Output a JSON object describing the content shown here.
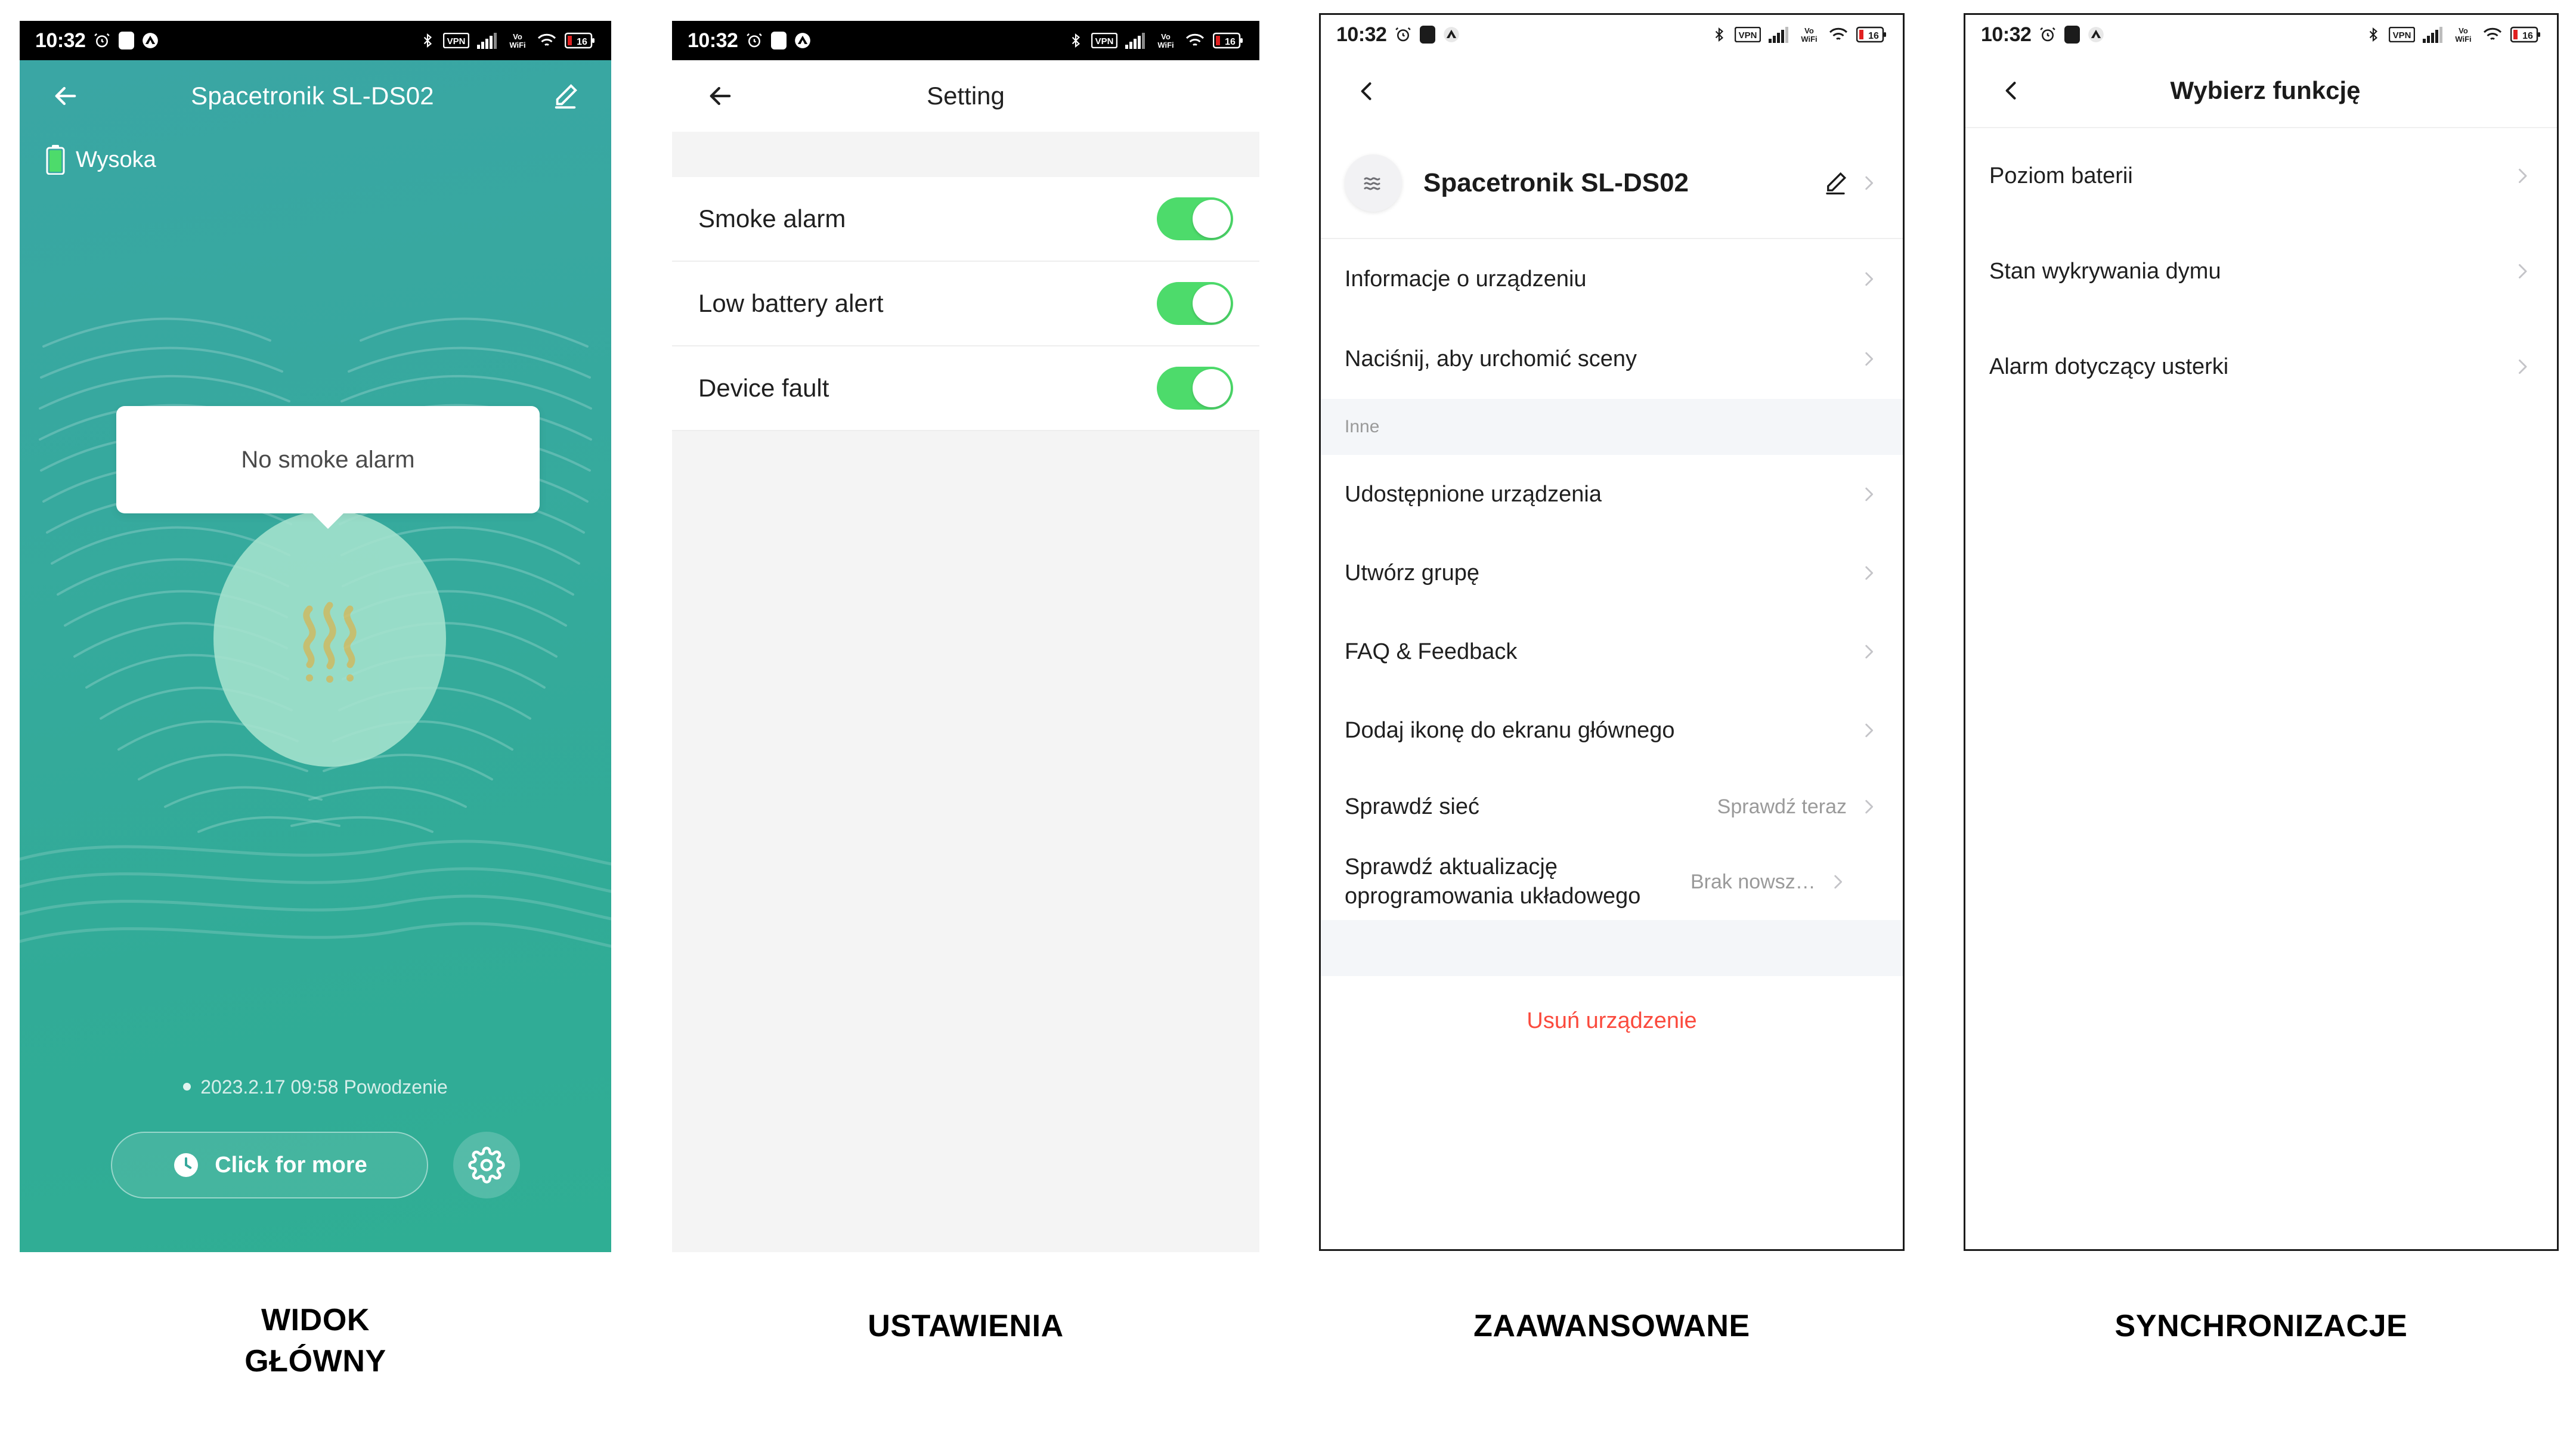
{
  "statusbar": {
    "time": "10:32",
    "icons_left": [
      "alarm-clock-icon",
      "do-not-disturb-icon",
      "nordvpn-icon"
    ],
    "icons_right": [
      "bluetooth-icon",
      "vpn-icon",
      "cellular-signal-icon",
      "volte-wifi-icon",
      "wifi-icon",
      "battery-icon"
    ],
    "battery_level": "16"
  },
  "panel1": {
    "caption": "WIDOK\nGŁÓWNY",
    "appbar": {
      "back_icon": "arrow-left-icon",
      "title": "Spacetronik SL-DS02",
      "edit_icon": "pencil-icon"
    },
    "battery": {
      "icon": "battery-full-icon",
      "label": "Wysoka"
    },
    "bubble": {
      "text": "No smoke alarm"
    },
    "blob_icon": "smoke-waves-icon",
    "log": {
      "bullet": "•",
      "text": "2023.2.17 09:58 Powodzenie"
    },
    "click_more": {
      "icon": "clock-icon",
      "label": "Click for more"
    },
    "gear": {
      "icon": "gear-icon"
    },
    "colors": {
      "teal_top": "#3aa6a4",
      "teal_bottom": "#2fae94",
      "blob": "#a5e3ce",
      "smoke": "#d9c26c"
    }
  },
  "panel2": {
    "caption": "USTAWIENIA",
    "appbar": {
      "back_icon": "arrow-left-icon",
      "title": "Setting"
    },
    "rows": [
      {
        "label": "Smoke alarm",
        "toggle": "on"
      },
      {
        "label": "Low battery alert",
        "toggle": "on"
      },
      {
        "label": "Device fault",
        "toggle": "on"
      }
    ],
    "colors": {
      "toggle_on": "#4ddb6b",
      "page_bg": "#f4f4f4"
    }
  },
  "panel3": {
    "caption": "ZAAWANSOWANE",
    "appbar": {
      "back_icon": "chevron-left-icon"
    },
    "device": {
      "avatar_icon": "smoke-waves-icon",
      "name": "Spacetronik SL-DS02",
      "edit_icon": "pencil-icon",
      "chevron_icon": "chevron-right-icon"
    },
    "rows_top": [
      {
        "label": "Informacje o urządzeniu",
        "value": "",
        "chevron": "chevron-right-icon"
      },
      {
        "label": "Naciśnij, aby urchomić sceny",
        "value": "",
        "chevron": "chevron-right-icon"
      }
    ],
    "section_label": "Inne",
    "rows_other": [
      {
        "label": "Udostępnione urządzenia",
        "value": "",
        "chevron": "chevron-right-icon"
      },
      {
        "label": "Utwórz grupę",
        "value": "",
        "chevron": "chevron-right-icon"
      },
      {
        "label": "FAQ & Feedback",
        "value": "",
        "chevron": "chevron-right-icon"
      },
      {
        "label": "Dodaj ikonę do ekranu głównego",
        "value": "",
        "chevron": "chevron-right-icon"
      },
      {
        "label": "Sprawdź sieć",
        "value": "Sprawdź teraz",
        "chevron": "chevron-right-icon"
      },
      {
        "label": "Sprawdź aktualizację oprogramowania układowego",
        "value": "Brak nowsz…",
        "chevron": "chevron-right-icon"
      }
    ],
    "delete_label": "Usuń urządzenie",
    "colors": {
      "section_bg": "#f4f6f9",
      "danger": "#fb4a3d"
    }
  },
  "panel4": {
    "caption": "SYNCHRONIZACJE",
    "appbar": {
      "back_icon": "chevron-left-icon",
      "title": "Wybierz funkcję"
    },
    "rows": [
      {
        "label": "Poziom baterii",
        "chevron": "chevron-right-icon"
      },
      {
        "label": "Stan wykrywania dymu",
        "chevron": "chevron-right-icon"
      },
      {
        "label": "Alarm dotyczący usterki",
        "chevron": "chevron-right-icon"
      }
    ]
  }
}
